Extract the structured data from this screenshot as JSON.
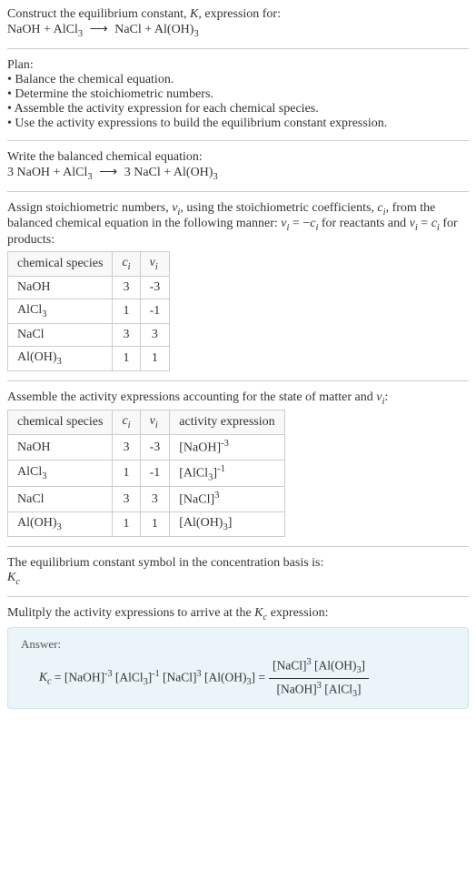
{
  "intro": {
    "line1": "Construct the equilibrium constant, K, expression for:",
    "equation": "NaOH + AlCl₃ ⟶ NaCl + Al(OH)₃"
  },
  "plan": {
    "heading": "Plan:",
    "items": [
      "• Balance the chemical equation.",
      "• Determine the stoichiometric numbers.",
      "• Assemble the activity expression for each chemical species.",
      "• Use the activity expressions to build the equilibrium constant expression."
    ]
  },
  "balanced": {
    "heading": "Write the balanced chemical equation:",
    "equation": "3 NaOH + AlCl₃ ⟶ 3 NaCl + Al(OH)₃"
  },
  "stoich": {
    "text": "Assign stoichiometric numbers, νᵢ, using the stoichiometric coefficients, cᵢ, from the balanced chemical equation in the following manner: νᵢ = −cᵢ for reactants and νᵢ = cᵢ for products:",
    "headers": [
      "chemical species",
      "cᵢ",
      "νᵢ"
    ],
    "rows": [
      {
        "species": "NaOH",
        "c": "3",
        "v": "-3"
      },
      {
        "species": "AlCl₃",
        "c": "1",
        "v": "-1"
      },
      {
        "species": "NaCl",
        "c": "3",
        "v": "3"
      },
      {
        "species": "Al(OH)₃",
        "c": "1",
        "v": "1"
      }
    ]
  },
  "activity": {
    "text": "Assemble the activity expressions accounting for the state of matter and νᵢ:",
    "headers": [
      "chemical species",
      "cᵢ",
      "νᵢ",
      "activity expression"
    ],
    "rows": [
      {
        "species": "NaOH",
        "c": "3",
        "v": "-3",
        "expr": "[NaOH]⁻³"
      },
      {
        "species": "AlCl₃",
        "c": "1",
        "v": "-1",
        "expr": "[AlCl₃]⁻¹"
      },
      {
        "species": "NaCl",
        "c": "3",
        "v": "3",
        "expr": "[NaCl]³"
      },
      {
        "species": "Al(OH)₃",
        "c": "1",
        "v": "1",
        "expr": "[Al(OH)₃]"
      }
    ]
  },
  "symbol": {
    "text": "The equilibrium constant symbol in the concentration basis is:",
    "sym": "K_c"
  },
  "multiply": {
    "text": "Mulitply the activity expressions to arrive at the K_c expression:"
  },
  "answer": {
    "label": "Answer:",
    "lhs": "K_c = [NaOH]⁻³ [AlCl₃]⁻¹ [NaCl]³ [Al(OH)₃] = ",
    "num": "[NaCl]³ [Al(OH)₃]",
    "den": "[NaOH]³ [AlCl₃]"
  }
}
